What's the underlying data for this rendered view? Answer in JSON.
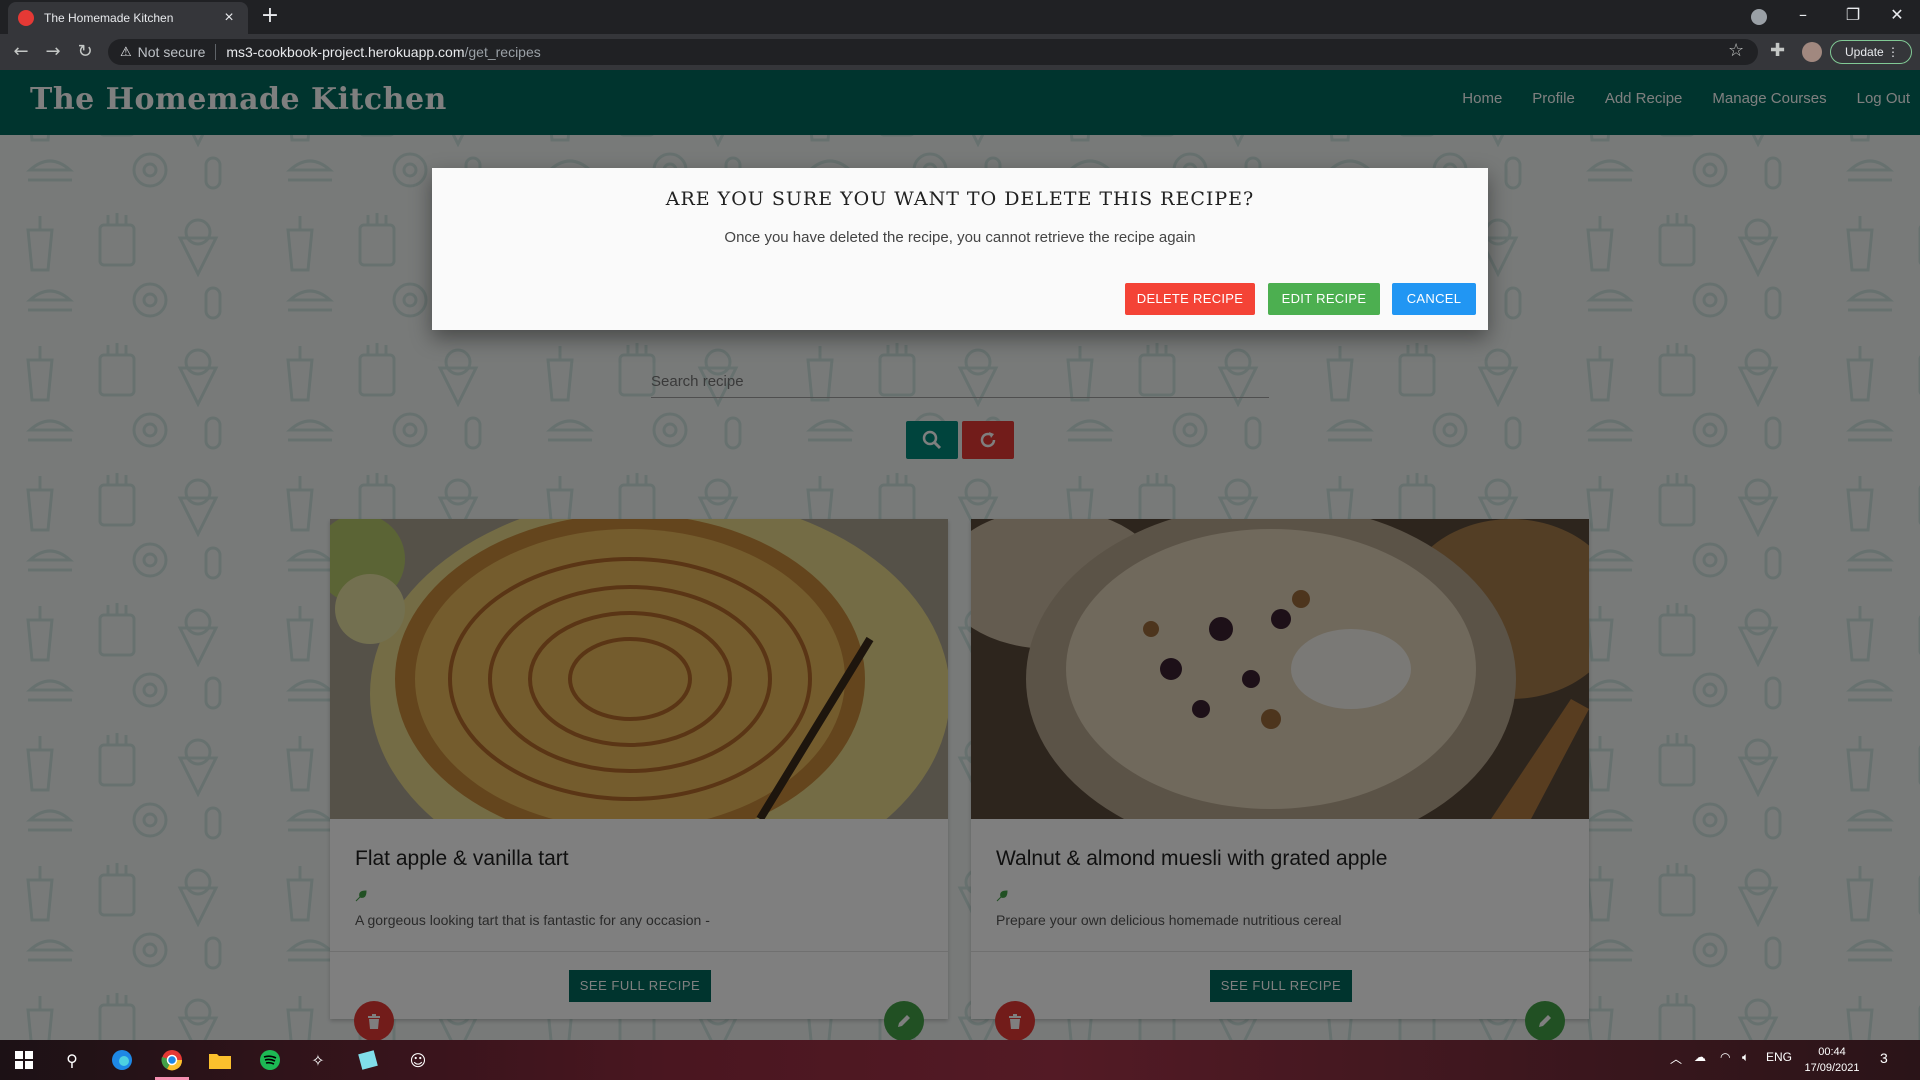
{
  "browser": {
    "tab_title": "The Homemade Kitchen",
    "tab_close": "×",
    "new_tab": "+",
    "url_warning": "Not secure",
    "url_host": "ms3-cookbook-project.herokuapp.com",
    "url_path": "/get_recipes",
    "update_label": "Update ⋮",
    "min": "–",
    "max": "❐",
    "close": "✕"
  },
  "site": {
    "brand": "The Homemade Kitchen",
    "nav": [
      "Home",
      "Profile",
      "Add Recipe",
      "Manage Courses",
      "Log Out"
    ],
    "search_placeholder": "Search recipe"
  },
  "recipes": [
    {
      "title": "Flat apple & vanilla tart",
      "description": "A gorgeous looking tart that is fantastic for any occasion -",
      "action": "SEE FULL RECIPE"
    },
    {
      "title": "Walnut & almond muesli with grated apple",
      "description": "Prepare your own delicious homemade nutritious cereal",
      "action": "SEE FULL RECIPE"
    }
  ],
  "modal": {
    "title": "ARE YOU SURE YOU WANT TO DELETE THIS RECIPE?",
    "text": "Once you have deleted the recipe, you cannot retrieve the recipe again",
    "delete_label": "DELETE RECIPE",
    "edit_label": "EDIT RECIPE",
    "cancel_label": "CANCEL"
  },
  "taskbar": {
    "language": "ENG",
    "time": "00:44",
    "date": "17/09/2021",
    "notifications": "3"
  },
  "colors": {
    "brand": "#00695c",
    "delete": "#f44336",
    "edit": "#4caf50",
    "cancel": "#2196f3"
  }
}
